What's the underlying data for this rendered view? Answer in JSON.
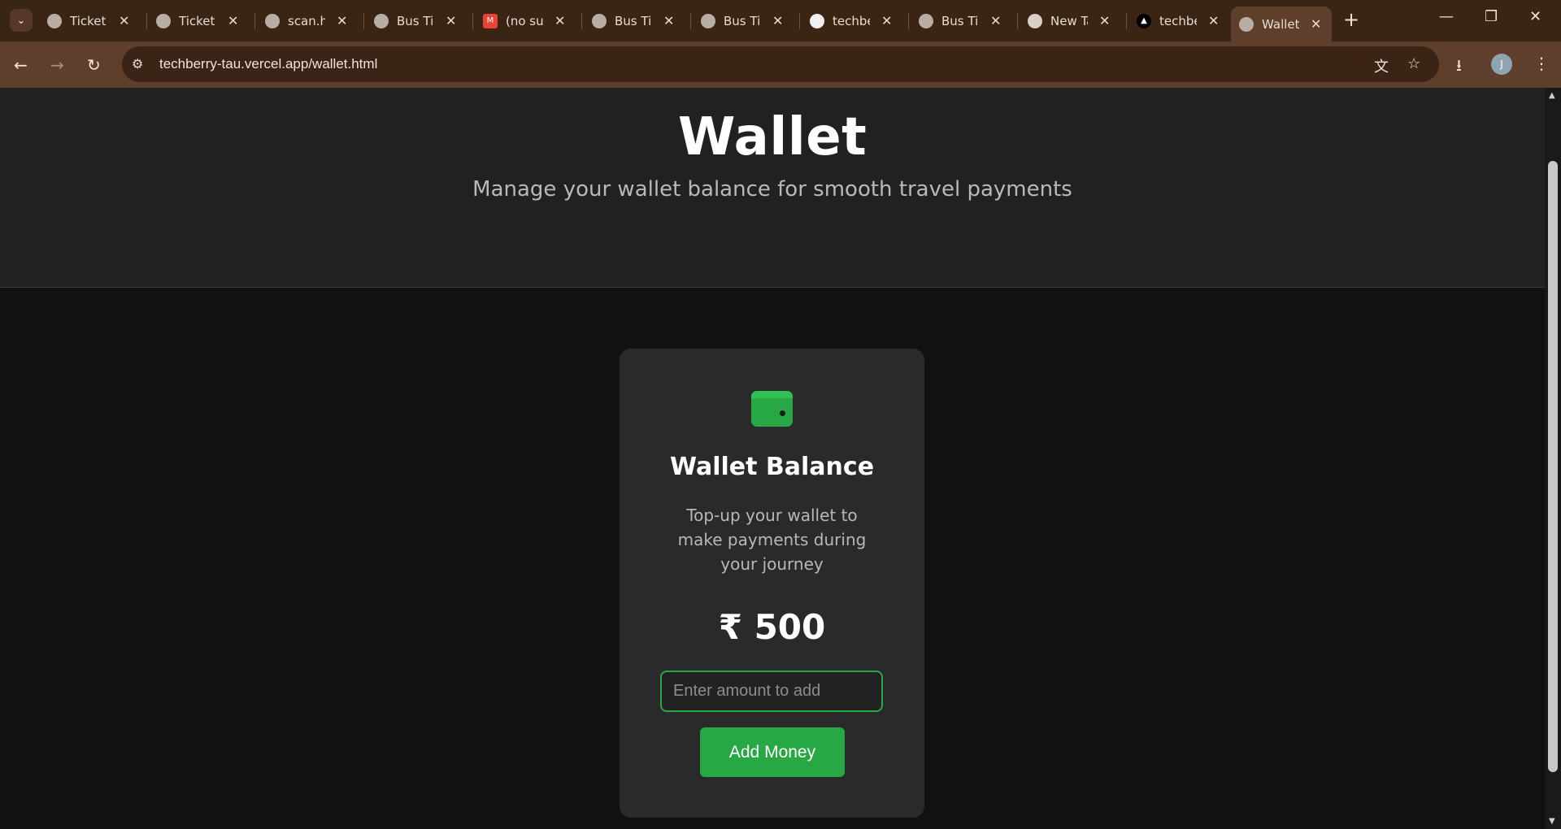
{
  "browser": {
    "tabs": [
      {
        "title": "Ticket",
        "icon": "globe-icon"
      },
      {
        "title": "Ticket",
        "icon": "globe-icon"
      },
      {
        "title": "scan.ht",
        "icon": "globe-icon"
      },
      {
        "title": "Bus Tic",
        "icon": "globe-icon"
      },
      {
        "title": "(no sul",
        "icon": "gmail-icon"
      },
      {
        "title": "Bus Tic",
        "icon": "globe-icon"
      },
      {
        "title": "Bus Tic",
        "icon": "globe-icon"
      },
      {
        "title": "techbe",
        "icon": "github-icon"
      },
      {
        "title": "Bus Tic",
        "icon": "globe-icon"
      },
      {
        "title": "New Ta",
        "icon": "chrome-icon"
      },
      {
        "title": "techbe",
        "icon": "vercel-icon"
      },
      {
        "title": "Wallet",
        "icon": "globe-icon",
        "active": true
      }
    ],
    "url": "techberry-tau.vercel.app/wallet.html",
    "profile_initial": "J"
  },
  "hero": {
    "title": "Wallet",
    "subtitle": "Manage your wallet balance for smooth travel payments"
  },
  "wallet": {
    "title": "Wallet Balance",
    "description": "Top-up your wallet to make payments during your journey",
    "balance": "₹ 500",
    "amount_value": "",
    "amount_placeholder": "Enter amount to add",
    "add_button": "Add Money"
  },
  "colors": {
    "accent": "#28a745",
    "chrome": "#5d3f2c",
    "page_bg": "#111111",
    "card_bg": "#2a2a2a"
  }
}
